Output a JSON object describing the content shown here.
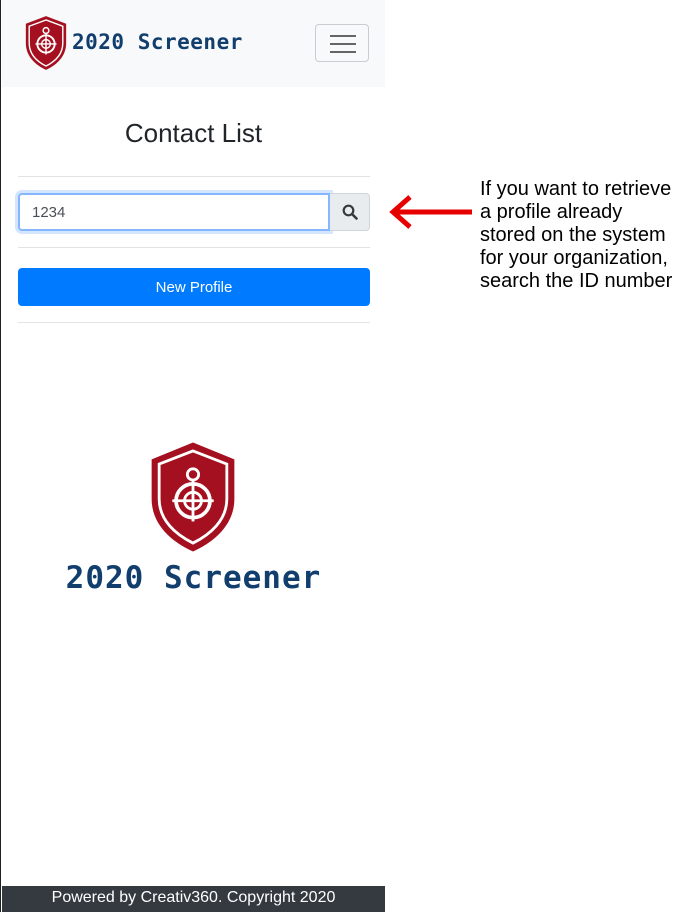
{
  "brand": {
    "name": "2020 Screener",
    "shield_color": "#a4101f",
    "text_color": "#123e6e"
  },
  "header": {
    "menu_icon": "hamburger-icon"
  },
  "main": {
    "title": "Contact List",
    "search": {
      "value": "1234",
      "placeholder": "",
      "button_icon": "search-icon"
    },
    "new_profile_label": "New Profile",
    "logo": {
      "name": "2020 Screener"
    }
  },
  "footer": {
    "text": "Powered by Creativ360. Copyright 2020"
  },
  "annotation": {
    "text": "If you want to retrieve a profile already stored on the system for your organization, search the ID number",
    "arrow_color": "#e60000"
  },
  "colors": {
    "primary": "#007bff",
    "navbar_bg": "#f8f9fa",
    "footer_bg": "#343a40"
  }
}
